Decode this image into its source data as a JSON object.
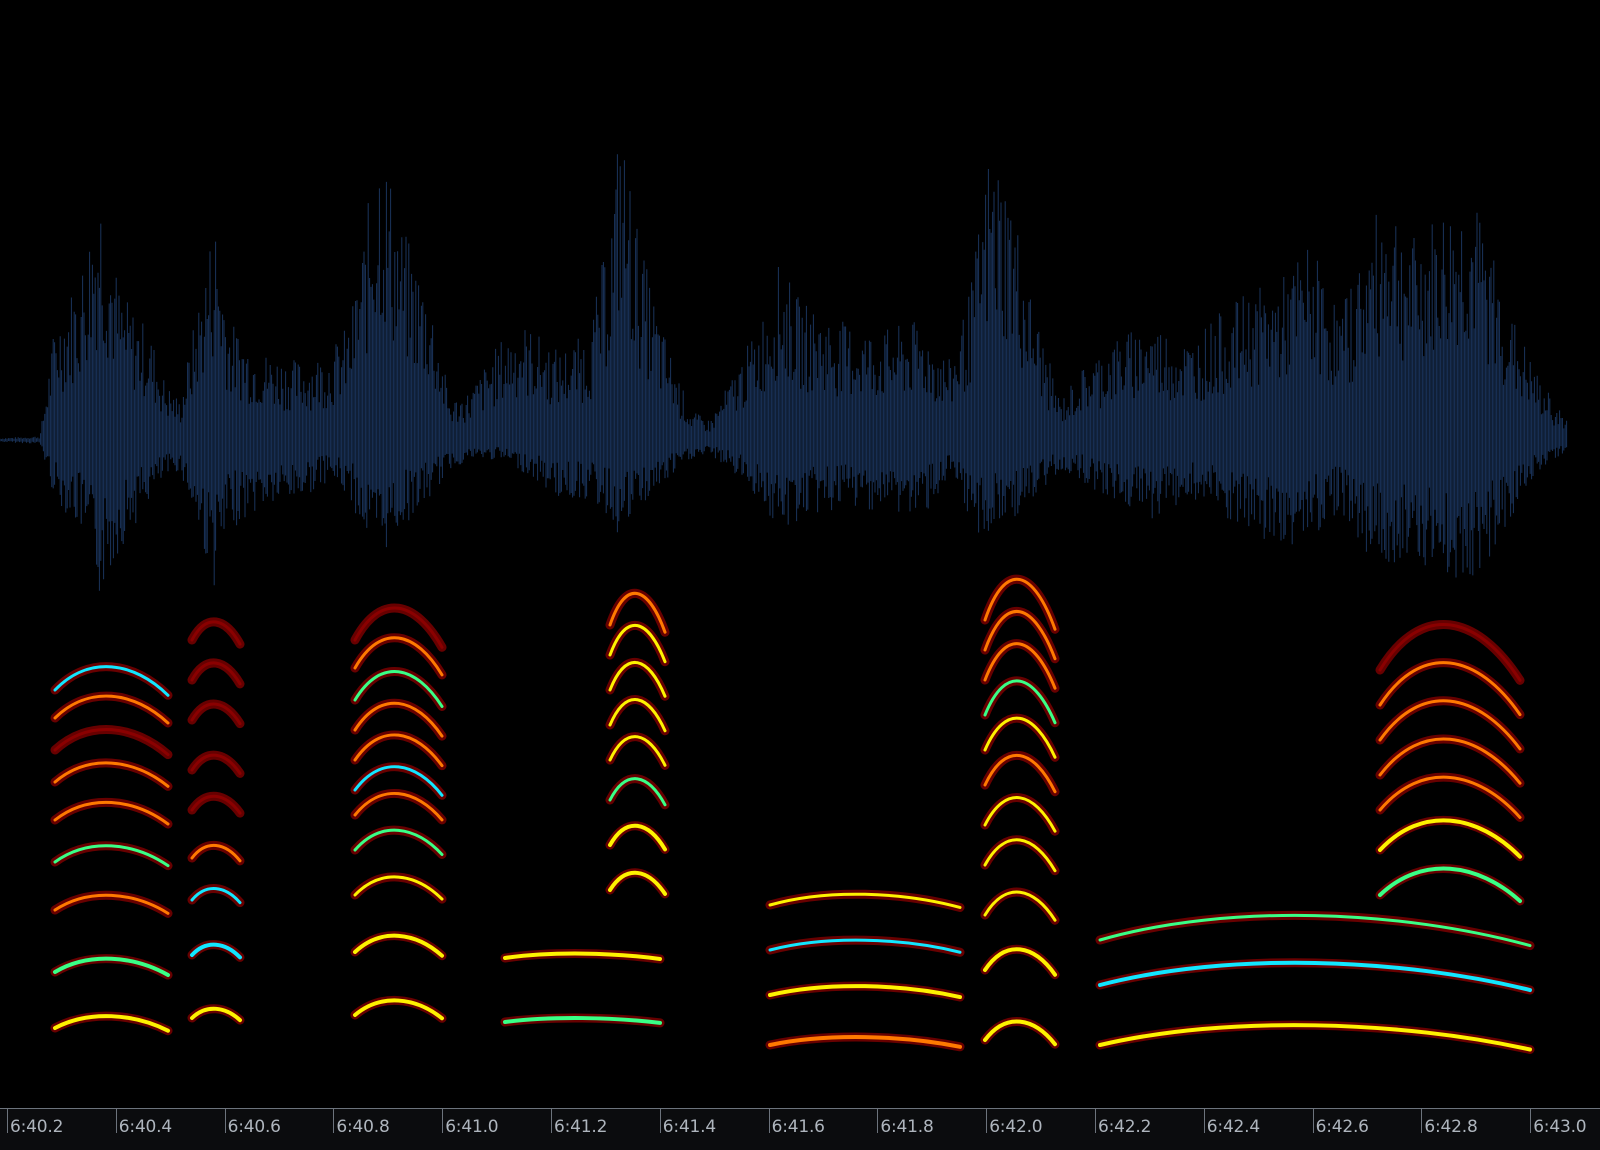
{
  "app": {
    "view": "spectrogram-waveform-overlay"
  },
  "colors": {
    "background": "#000000",
    "waveform": "#1b3760",
    "timeline_bg": "#0b0c0e",
    "timeline_text": "#aeb5bd",
    "timeline_line": "#6c737c",
    "heat_low": "#8a0000",
    "heat_mid": "#ff7a00",
    "heat_high": "#fff200",
    "heat_peak": "#39ff86",
    "heat_max": "#12e6ff"
  },
  "timeline": {
    "labels": [
      "6:40.2",
      "6:40.4",
      "6:40.6",
      "6:40.8",
      "6:41.0",
      "6:41.2",
      "6:41.4",
      "6:41.6",
      "6:41.8",
      "6:42.0",
      "6:42.2",
      "6:42.4",
      "6:42.6",
      "6:42.8",
      "6:43.0"
    ]
  }
}
